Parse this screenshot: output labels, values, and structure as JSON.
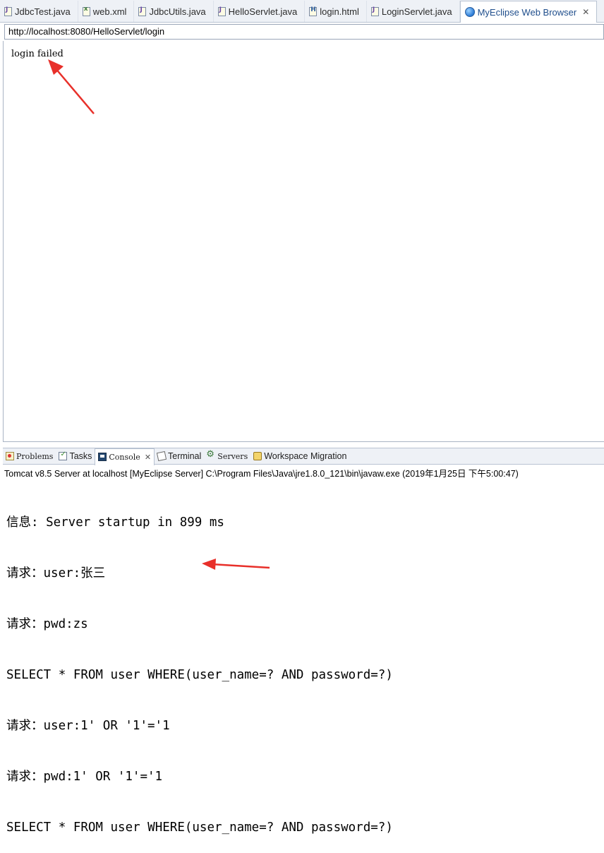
{
  "editor": {
    "tabs": [
      {
        "label": "JdbcTest.java",
        "icon": "java-file-icon"
      },
      {
        "label": "web.xml",
        "icon": "xml-file-icon"
      },
      {
        "label": "JdbcUtils.java",
        "icon": "java-file-icon"
      },
      {
        "label": "HelloServlet.java",
        "icon": "java-file-icon"
      },
      {
        "label": "login.html",
        "icon": "html-file-icon"
      },
      {
        "label": "LoginServlet.java",
        "icon": "java-file-icon"
      },
      {
        "label": "MyEclipse Web Browser",
        "icon": "globe-icon",
        "active": true
      }
    ],
    "close_glyph": "✕"
  },
  "browser": {
    "url": "http://localhost:8080/HelloServlet/login",
    "page_text": "login failed"
  },
  "views": {
    "tabs": [
      {
        "label": "Problems",
        "icon": "problems-icon"
      },
      {
        "label": "Tasks",
        "icon": "tasks-icon"
      },
      {
        "label": "Console",
        "icon": "console-icon",
        "active": true
      },
      {
        "label": "Terminal",
        "icon": "terminal-icon"
      },
      {
        "label": "Servers",
        "icon": "servers-icon"
      },
      {
        "label": "Workspace Migration",
        "icon": "workspace-migration-icon"
      }
    ],
    "close_glyph": "✕"
  },
  "console": {
    "title": "Tomcat v8.5 Server at localhost [MyEclipse Server] C:\\Program Files\\Java\\jre1.8.0_121\\bin\\javaw.exe (2019年1月25日 下午5:00:47)",
    "lines": [
      "信息: Server startup in 899 ms",
      "请求：user:张三",
      "请求：pwd:zs",
      "SELECT * FROM user WHERE(user_name=? AND password=?)",
      "请求：user:1' OR '1'='1",
      "请求：pwd:1' OR '1'='1",
      "SELECT * FROM user WHERE(user_name=? AND password=?)"
    ]
  },
  "annotations": {
    "arrow_color": "#e8302a"
  }
}
